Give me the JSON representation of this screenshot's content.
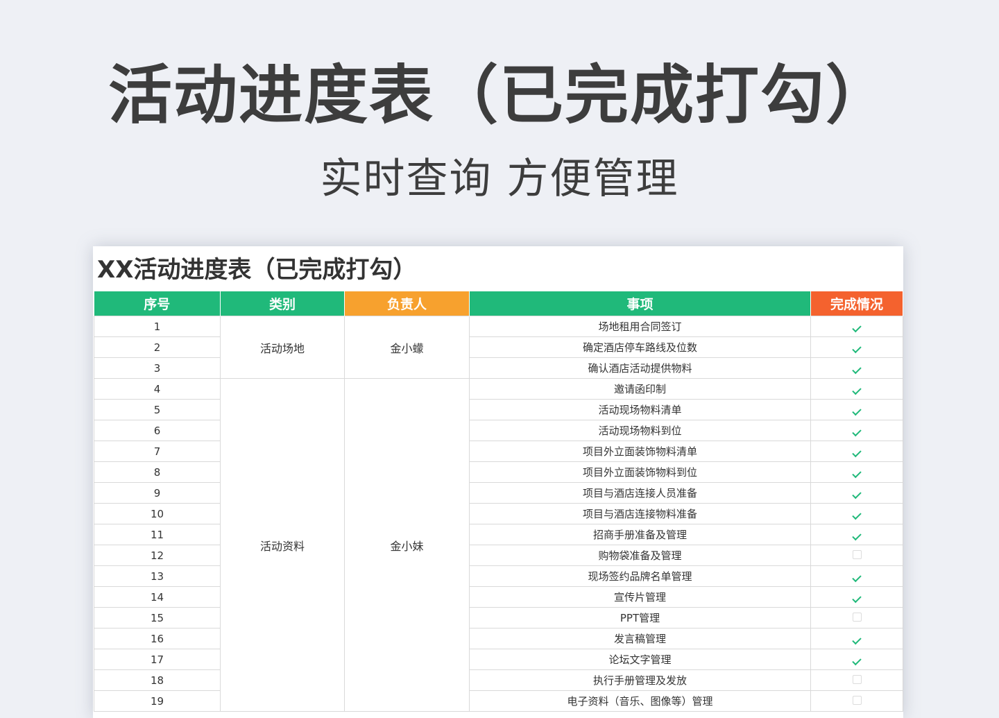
{
  "hero": {
    "title": "活动进度表（已完成打勾）",
    "subtitle": "实时查询 方便管理"
  },
  "sheet": {
    "title": "XX活动进度表（已完成打勾）",
    "headers": [
      "序号",
      "类别",
      "负责人",
      "事项",
      "完成情况"
    ],
    "colors": {
      "green": "#20b97a",
      "orange": "#f7a12e",
      "red_orange": "#f4622e"
    },
    "groups": [
      {
        "category": "活动场地",
        "owner": "金小蠓",
        "start": 0,
        "span": 3
      },
      {
        "category": "活动资料",
        "owner": "金小妹",
        "start": 3,
        "span": 16
      }
    ],
    "rows": [
      {
        "no": "1",
        "item": "场地租用合同签订",
        "done": true
      },
      {
        "no": "2",
        "item": "确定酒店停车路线及位数",
        "done": true
      },
      {
        "no": "3",
        "item": "确认酒店活动提供物料",
        "done": true
      },
      {
        "no": "4",
        "item": "邀请函印制",
        "done": true
      },
      {
        "no": "5",
        "item": "活动现场物料清单",
        "done": true
      },
      {
        "no": "6",
        "item": "活动现场物料到位",
        "done": true
      },
      {
        "no": "7",
        "item": "项目外立面装饰物料清单",
        "done": true
      },
      {
        "no": "8",
        "item": "项目外立面装饰物料到位",
        "done": true
      },
      {
        "no": "9",
        "item": "项目与酒店连接人员准备",
        "done": true
      },
      {
        "no": "10",
        "item": "项目与酒店连接物料准备",
        "done": true
      },
      {
        "no": "11",
        "item": "招商手册准备及管理",
        "done": true
      },
      {
        "no": "12",
        "item": "购物袋准备及管理",
        "done": false
      },
      {
        "no": "13",
        "item": "现场签约品牌名单管理",
        "done": true
      },
      {
        "no": "14",
        "item": "宣传片管理",
        "done": true
      },
      {
        "no": "15",
        "item": "PPT管理",
        "done": false
      },
      {
        "no": "16",
        "item": "发言稿管理",
        "done": true
      },
      {
        "no": "17",
        "item": "论坛文字管理",
        "done": true
      },
      {
        "no": "18",
        "item": "执行手册管理及发放",
        "done": false
      },
      {
        "no": "19",
        "item": "电子资料（音乐、图像等）管理",
        "done": false
      }
    ]
  }
}
